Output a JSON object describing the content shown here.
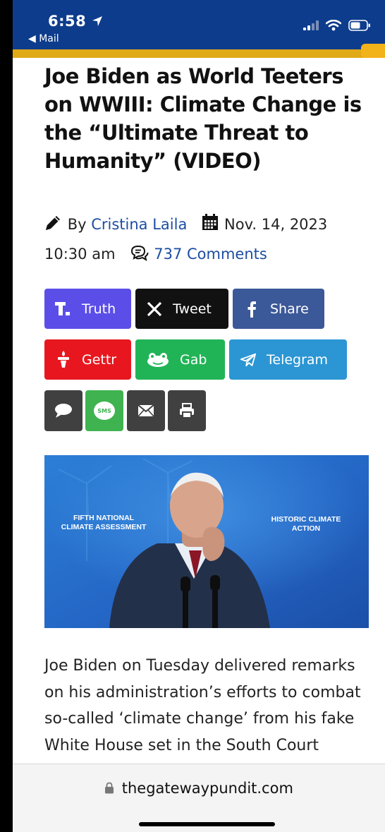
{
  "status_bar": {
    "time": "6:58",
    "back_app": "Mail",
    "icons": [
      "location-arrow-icon",
      "signal-icon",
      "wifi-icon",
      "battery-icon"
    ]
  },
  "article": {
    "title": "Joe Biden as World Teeters on WWIII: Climate Change is the “Ultimate Threat to Humanity” (VIDEO)",
    "by_prefix": "By",
    "author": "Cristina Laila",
    "date": "Nov. 14, 2023",
    "time": "10:30 am",
    "comments": "737 Comments",
    "body": "Joe Biden on Tuesday delivered remarks on his administration’s efforts to combat so-called ‘climate change’ from his fake White House set in the South Court Auditorium."
  },
  "share_buttons": {
    "truth": "Truth",
    "tweet": "Tweet",
    "share": "Share",
    "gettr": "Gettr",
    "gab": "Gab",
    "telegram": "Telegram",
    "sms": "SMS"
  },
  "photo": {
    "left_caption_line1": "FIFTH NATIONAL",
    "left_caption_line2": "CLIMATE ASSESSMENT",
    "right_caption_line1": "HISTORIC CLIMATE",
    "right_caption_line2": "ACTION"
  },
  "browser": {
    "url": "thegatewaypundit.com"
  },
  "colors": {
    "header_blue": "#0d3c8c",
    "gold": "#e0aa17",
    "link_blue": "#1d4ea2",
    "truth": "#5b4ee8",
    "tweet": "#111111",
    "share": "#3b5898",
    "gettr": "#e8171f",
    "gab": "#21b457",
    "telegram": "#2b96d3",
    "sms": "#3fb34f",
    "dark_gray": "#404040"
  }
}
